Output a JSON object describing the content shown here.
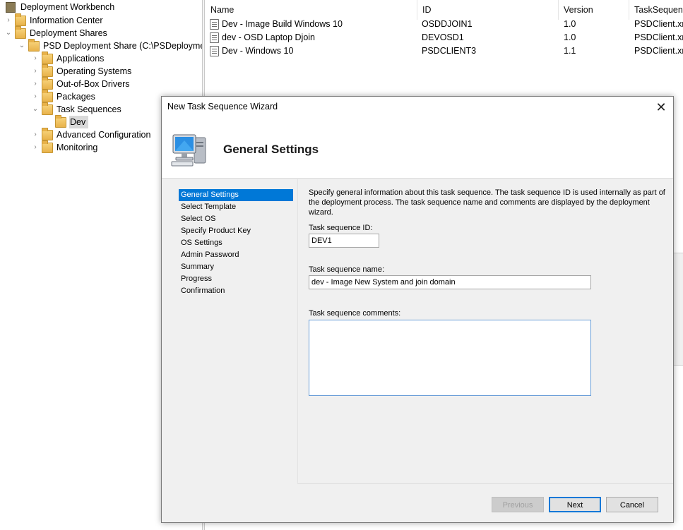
{
  "tree": {
    "root": "Deployment Workbench",
    "nodes": [
      {
        "label": "Information Center",
        "chevron": "›",
        "icon": "info-center-icon"
      },
      {
        "label": "Deployment Shares",
        "chevron": "⌄",
        "icon": "folder-icon"
      },
      {
        "label": "PSD Deployment Share (C:\\PSDeployment)",
        "chevron": "⌄",
        "icon": "deployment-share-icon"
      },
      {
        "label": "Applications",
        "chevron": "›",
        "icon": "applications-icon"
      },
      {
        "label": "Operating Systems",
        "chevron": "›",
        "icon": "operating-systems-icon"
      },
      {
        "label": "Out-of-Box Drivers",
        "chevron": "›",
        "icon": "drivers-icon"
      },
      {
        "label": "Packages",
        "chevron": "›",
        "icon": "packages-icon"
      },
      {
        "label": "Task Sequences",
        "chevron": "⌄",
        "icon": "task-sequences-icon"
      },
      {
        "label": "Dev",
        "chevron": "",
        "icon": "folder-icon"
      },
      {
        "label": "Advanced Configuration",
        "chevron": "›",
        "icon": "folder-icon"
      },
      {
        "label": "Monitoring",
        "chevron": "›",
        "icon": "monitoring-icon"
      }
    ]
  },
  "list": {
    "columns": [
      "Name",
      "ID",
      "Version",
      "TaskSequence"
    ],
    "rows": [
      {
        "name": "Dev - Image Build Windows 10",
        "id": "OSDDJOIN1",
        "version": "1.0",
        "template": "PSDClient.xml"
      },
      {
        "name": "dev - OSD Laptop Djoin",
        "id": "DEVOSD1",
        "version": "1.0",
        "template": "PSDClient.xml"
      },
      {
        "name": "Dev - Windows 10",
        "id": "PSDCLIENT3",
        "version": "1.1",
        "template": "PSDClient.xml"
      }
    ]
  },
  "dialog": {
    "title": "New Task Sequence Wizard",
    "close": "✕",
    "heading": "General Settings",
    "steps": [
      "General Settings",
      "Select Template",
      "Select OS",
      "Specify Product Key",
      "OS Settings",
      "Admin Password",
      "Summary",
      "Progress",
      "Confirmation"
    ],
    "active_step": "General Settings",
    "description": "Specify general information about this task sequence.  The task sequence ID is used internally as part of the deployment process.  The task sequence name and comments are displayed by the deployment wizard.",
    "fields": {
      "id_label": "Task sequence ID:",
      "id_value": "DEV1",
      "name_label": "Task sequence name:",
      "name_value": "dev - Image New System and join domain",
      "comments_label": "Task sequence comments:",
      "comments_value": ""
    },
    "buttons": {
      "previous": "Previous",
      "next": "Next",
      "cancel": "Cancel"
    }
  },
  "colors": {
    "selection": "#0078d7",
    "dialog_bg": "#f0f0f0"
  }
}
